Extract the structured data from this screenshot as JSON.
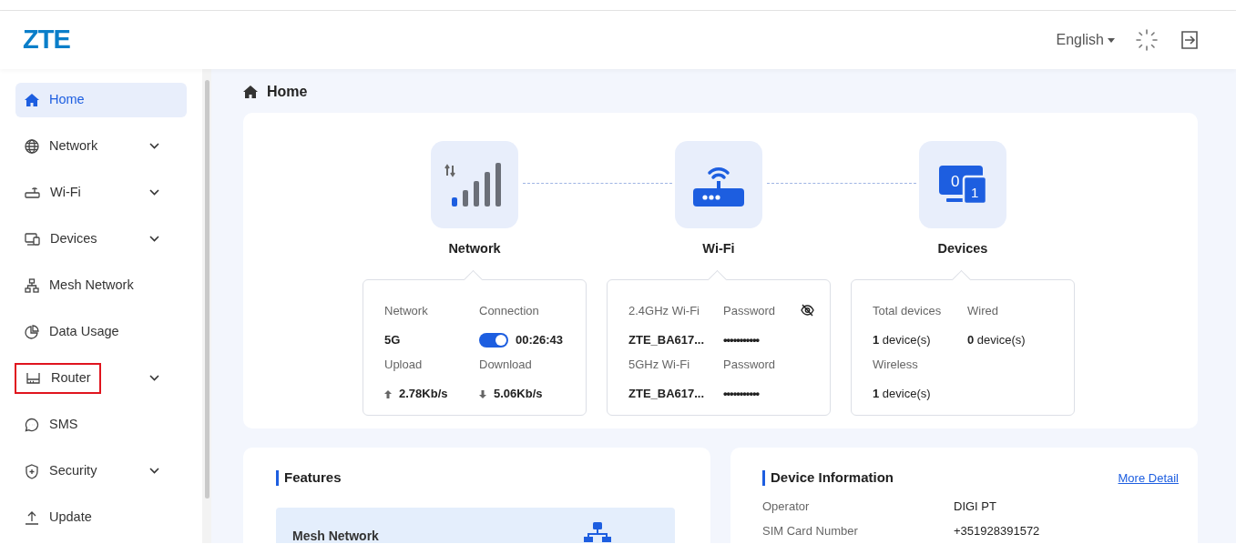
{
  "logo": "ZTE",
  "header": {
    "language": "English"
  },
  "sidebar": {
    "items": [
      {
        "label": "Home",
        "selected": true,
        "expandable": false,
        "outlined": false
      },
      {
        "label": "Network",
        "selected": false,
        "expandable": true,
        "outlined": false
      },
      {
        "label": "Wi-Fi",
        "selected": false,
        "expandable": true,
        "outlined": false
      },
      {
        "label": "Devices",
        "selected": false,
        "expandable": true,
        "outlined": false
      },
      {
        "label": "Mesh Network",
        "selected": false,
        "expandable": false,
        "outlined": false
      },
      {
        "label": "Data Usage",
        "selected": false,
        "expandable": false,
        "outlined": false
      },
      {
        "label": "Router",
        "selected": false,
        "expandable": true,
        "outlined": true
      },
      {
        "label": "SMS",
        "selected": false,
        "expandable": false,
        "outlined": false
      },
      {
        "label": "Security",
        "selected": false,
        "expandable": true,
        "outlined": false
      },
      {
        "label": "Update",
        "selected": false,
        "expandable": false,
        "outlined": false
      }
    ]
  },
  "breadcrumb": "Home",
  "overview": {
    "nodes": [
      {
        "kind": "network",
        "title": "Network",
        "fields": [
          {
            "kind": "text",
            "label": "Network",
            "value": "5G"
          },
          {
            "kind": "toggle",
            "label": "Connection",
            "value": "00:26:43",
            "on": true
          },
          {
            "kind": "upload",
            "label": "Upload",
            "value": "2.78Kb/s"
          },
          {
            "kind": "download",
            "label": "Download",
            "value": "5.06Kb/s"
          }
        ]
      },
      {
        "kind": "wifi",
        "title": "Wi-Fi",
        "fields": [
          {
            "kind": "text",
            "label": "2.4GHz Wi-Fi",
            "value": "ZTE_BA617..."
          },
          {
            "kind": "password",
            "label": "Password",
            "value": "•••••••••••",
            "eye_icon": true
          },
          {
            "kind": "text",
            "label": "5GHz Wi-Fi",
            "value": "ZTE_BA617..."
          },
          {
            "kind": "password",
            "label": "Password",
            "value": "•••••••••••",
            "eye_icon": false
          }
        ]
      },
      {
        "kind": "devices",
        "title": "Devices",
        "icon_numbers": [
          "0",
          "1"
        ],
        "fields": [
          {
            "kind": "count",
            "label": "Total devices",
            "value": "**1** device(s)"
          },
          {
            "kind": "count",
            "label": "Wired",
            "value": "**0** device(s)"
          },
          {
            "kind": "count",
            "label": "Wireless",
            "value": "**1** device(s)"
          }
        ]
      }
    ]
  },
  "features": {
    "title": "Features",
    "items": [
      {
        "label": "Mesh Network"
      }
    ]
  },
  "device_information": {
    "title": "Device Information",
    "link": "More Detail",
    "rows": [
      {
        "label": "Operator",
        "value": "DIGI PT"
      },
      {
        "label": "SIM Card Number",
        "value": "+351928391572"
      }
    ]
  }
}
